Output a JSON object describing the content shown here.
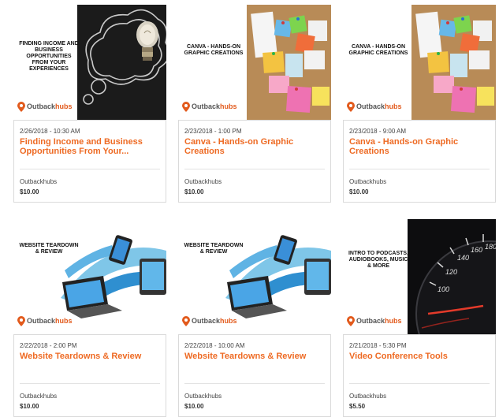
{
  "brand": {
    "prefix": "Outback",
    "suffix": "hubs"
  },
  "colors": {
    "accent": "#ee6a23",
    "text": "#444444",
    "border": "#dadada"
  },
  "events": [
    {
      "banner_title": "FINDING INCOME AND BUSINESS OPPORTUNITIES FROM YOUR EXPERIENCES",
      "image": "lightbulb-chalkboard",
      "date": "2/26/2018 - 10:30 AM",
      "title": "Finding Income and Business Opportunities From Your...",
      "organizer": "Outbackhubs",
      "price": "$10.00"
    },
    {
      "banner_title": "CANVA - HANDS-ON GRAPHIC CREATIONS",
      "image": "corkboard-sticky-notes",
      "date": "2/23/2018 - 1:00 PM",
      "title": "Canva - Hands-on Graphic Creations",
      "organizer": "Outbackhubs",
      "price": "$10.00"
    },
    {
      "banner_title": "CANVA - HANDS-ON GRAPHIC CREATIONS",
      "image": "corkboard-sticky-notes",
      "date": "2/23/2018 - 9:00 AM",
      "title": "Canva - Hands-on Graphic Creations",
      "organizer": "Outbackhubs",
      "price": "$10.00"
    },
    {
      "banner_title": "WEBSITE TEARDOWN & REVIEW",
      "image": "devices-illustration",
      "date": "2/22/2018 - 2:00 PM",
      "title": "Website Teardowns & Review",
      "organizer": "Outbackhubs",
      "price": "$10.00"
    },
    {
      "banner_title": "WEBSITE TEARDOWN & REVIEW",
      "image": "devices-illustration",
      "date": "2/22/2018 - 10:00 AM",
      "title": "Website Teardowns & Review",
      "organizer": "Outbackhubs",
      "price": "$10.00"
    },
    {
      "banner_title": "INTRO TO PODCASTS, AUDIOBOOKS, MUSIC & MORE",
      "image": "speedometer-dark",
      "date": "2/21/2018 - 5:30 PM",
      "title": "Video Conference Tools",
      "organizer": "Outbackhubs",
      "price": "$5.50"
    }
  ]
}
